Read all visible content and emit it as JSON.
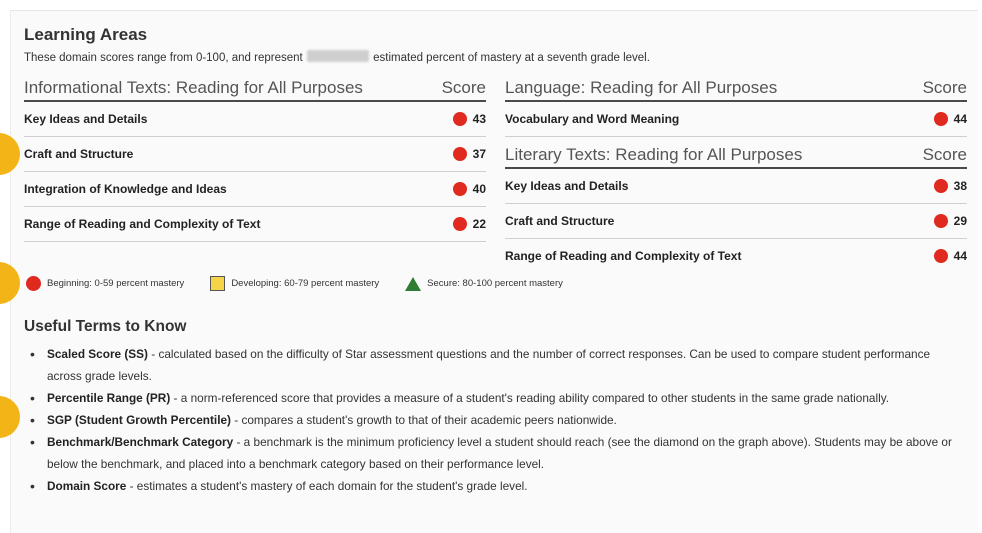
{
  "section": {
    "title": "Learning Areas",
    "subtitle_before": "These domain scores range from 0-100, and represent",
    "subtitle_after": "estimated percent of mastery at a seventh grade level."
  },
  "colors": {
    "beginning": "#e0291f",
    "developing": "#f5d547",
    "secure": "#2e7d32",
    "marker": "#f2b416"
  },
  "tables": {
    "informational": {
      "heading": "Informational Texts: Reading for All Purposes",
      "score_label": "Score",
      "rows": [
        {
          "label": "Key Ideas and Details",
          "score": "43"
        },
        {
          "label": "Craft and Structure",
          "score": "37"
        },
        {
          "label": "Integration of Knowledge and Ideas",
          "score": "40"
        },
        {
          "label": "Range of Reading and Complexity of Text",
          "score": "22"
        }
      ]
    },
    "language": {
      "heading": "Language: Reading for All Purposes",
      "score_label": "Score",
      "rows": [
        {
          "label": "Vocabulary and Word Meaning",
          "score": "44"
        }
      ]
    },
    "literary": {
      "heading": "Literary Texts: Reading for All Purposes",
      "score_label": "Score",
      "rows": [
        {
          "label": "Key Ideas and Details",
          "score": "38"
        },
        {
          "label": "Craft and Structure",
          "score": "29"
        },
        {
          "label": "Range of Reading and Complexity of Text",
          "score": "44"
        }
      ]
    }
  },
  "legend": {
    "beginning": "Beginning: 0-59 percent mastery",
    "developing": "Developing: 60-79 percent mastery",
    "secure": "Secure: 80-100 percent mastery"
  },
  "terms": {
    "title": "Useful Terms to Know",
    "items": [
      {
        "term": "Scaled Score (SS)",
        "desc": " - calculated based on the difficulty of Star assessment questions and the number of correct responses. Can be used to compare student performance across grade levels."
      },
      {
        "term": "Percentile Range (PR)",
        "desc": " - a norm-referenced score that provides a measure of a student's reading ability compared to other students in the same grade nationally."
      },
      {
        "term": "SGP (Student Growth Percentile)",
        "desc": " - compares a student's growth to that of their academic peers nationwide."
      },
      {
        "term": "Benchmark/Benchmark Category",
        "desc": " - a benchmark is the minimum proficiency level a student should reach (see the diamond on the graph above). Students may be above or below the benchmark, and placed into a benchmark category based on their performance level."
      },
      {
        "term": "Domain Score",
        "desc": " - estimates a student's mastery of each domain for the student's grade level."
      }
    ]
  }
}
